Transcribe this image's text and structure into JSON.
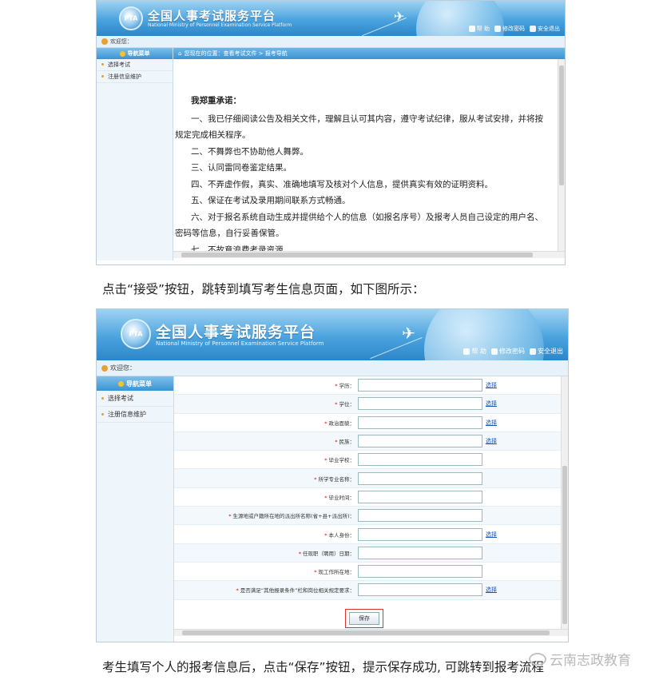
{
  "colors": {
    "banner": "#3b93d4",
    "highlight": "#e03030",
    "link": "#1a55c0"
  },
  "banner": {
    "logo_text": "PTA",
    "title": "全国人事考试服务平台",
    "subtitle": "National Ministry of Personnel Examination Service Platform",
    "nav": [
      "帮 助",
      "修改密码",
      "安全退出"
    ]
  },
  "welcome": "欢迎您：",
  "sidebar": {
    "header": "导航菜单",
    "items": [
      "选择考试",
      "注册信息维护"
    ]
  },
  "screen1": {
    "breadcrumb": "您现在的位置：查看考试文件 > 报考导航",
    "heading": "我郑重承诺：",
    "paragraphs": [
      "一、我已仔细阅读公告及相关文件，理解且认可其内容，遵守考试纪律，服从考试安排，并将按规定完成相关程序。",
      "二、不舞弊也不协助他人舞弊。",
      "三、认同雷同卷鉴定结果。",
      "四、不弄虚作假，真实、准确地填写及核对个人信息，提供真实有效的证明资料。",
      "五、保证在考试及录用期间联系方式畅通。",
      "六、对于报名系统自动生成并提供给个人的信息（如报名序号）及报考人员自己设定的用户名、密码等信息，自行妥善保管。",
      "七、不故意浪费考录资源。"
    ]
  },
  "caption1": "点击“接受”按钮，跳转到填写考生信息页面，如下图所示：",
  "screen2": {
    "fields": [
      {
        "label": "学历：",
        "select": "选择"
      },
      {
        "label": "学位：",
        "select": "选择"
      },
      {
        "label": "政治面貌：",
        "select": "选择"
      },
      {
        "label": "民族：",
        "select": "选择"
      },
      {
        "label": "毕业学校：",
        "select": ""
      },
      {
        "label": "所学专业名称：",
        "select": ""
      },
      {
        "label": "毕业时间：",
        "select": ""
      },
      {
        "label": "生源地或户籍所在地的派出所名称(省+县+派出所)：",
        "select": ""
      },
      {
        "label": "本人身份：",
        "select": "选择"
      },
      {
        "label": "任现职（聘用）日期：",
        "select": ""
      },
      {
        "label": "现工作所在地：",
        "select": ""
      },
      {
        "label": "是否满足“其他报录条件”栏和岗位相关规定要求：",
        "select": "选择"
      }
    ],
    "save": "保存"
  },
  "caption2": "考生填写个人的报考信息后，点击“保存”按钮，提示保存成功, 可跳转到报考流程",
  "watermark": "云南志政教育"
}
